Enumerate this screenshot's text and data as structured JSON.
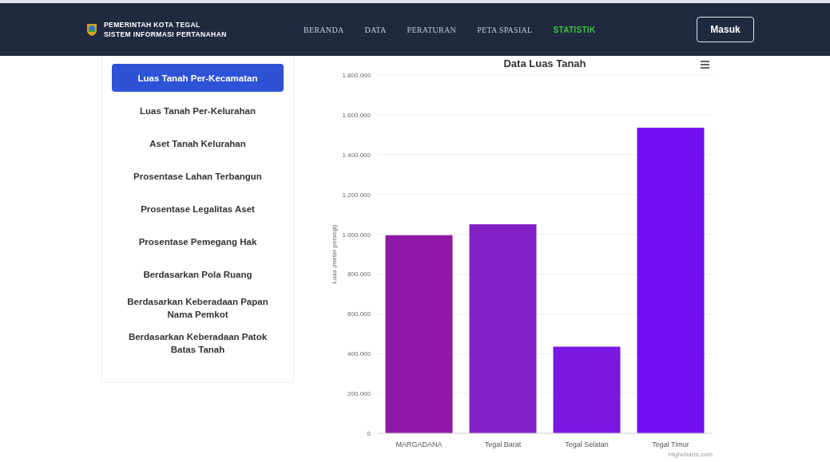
{
  "header": {
    "title_lines": [
      "PEMERINTAH KOTA TEGAL",
      "SISTEM INFORMASI PERTANAHAN"
    ],
    "nav": [
      {
        "label": "BERANDA",
        "selected": false
      },
      {
        "label": "DATA",
        "selected": false
      },
      {
        "label": "PERATURAN",
        "selected": false
      },
      {
        "label": "PETA SPASIAL",
        "selected": false
      },
      {
        "label": "STATISTIK",
        "selected": true
      }
    ],
    "login_button": "Masuk"
  },
  "sidebar": {
    "items": [
      {
        "label": "Luas Tanah Per-Kecamatan",
        "selected": true
      },
      {
        "label": "Luas Tanah Per-Kelurahan",
        "selected": false
      },
      {
        "label": "Aset Tanah Kelurahan",
        "selected": false
      },
      {
        "label": "Prosentase Lahan Terbangun",
        "selected": false
      },
      {
        "label": "Prosentase Legalitas Aset",
        "selected": false
      },
      {
        "label": "Prosentase Pemegang Hak",
        "selected": false
      },
      {
        "label": "Berdasarkan Pola Ruang",
        "selected": false
      },
      {
        "label": "Berdasarkan Keberadaan Papan Nama Pemkot",
        "selected": false
      },
      {
        "label": "Berdasarkan Keberadaan Patok Batas Tanah",
        "selected": false
      }
    ]
  },
  "chart": {
    "credit": "Highcharts.com",
    "bars": [
      {
        "color": "#8e18a8"
      },
      {
        "color": "#8420c8"
      },
      {
        "color": "#7818e0"
      },
      {
        "color": "#7010f0"
      }
    ],
    "chart_data": {
      "type": "bar",
      "title": "Data Luas Tanah",
      "ylabel": "Luas (meter persegi)",
      "categories": [
        "MARGADANA",
        "Tegal Barat",
        "Tegal Selatan",
        "Tegal Timur"
      ],
      "values": [
        995000,
        1050000,
        435000,
        1535000
      ],
      "grid": true,
      "ylim": [
        0,
        1800000
      ],
      "yticks": [
        {
          "value": 0,
          "label": "0"
        },
        {
          "value": 200000,
          "label": "200.000"
        },
        {
          "value": 400000,
          "label": "400.000"
        },
        {
          "value": 600000,
          "label": "600.000"
        },
        {
          "value": 800000,
          "label": "800.000"
        },
        {
          "value": 1000000,
          "label": "1.000.000"
        },
        {
          "value": 1200000,
          "label": "1.200.000"
        },
        {
          "value": 1400000,
          "label": "1.400.000"
        },
        {
          "value": 1600000,
          "label": "1.600.000"
        },
        {
          "value": 1800000,
          "label": "1.800.000"
        }
      ]
    }
  }
}
